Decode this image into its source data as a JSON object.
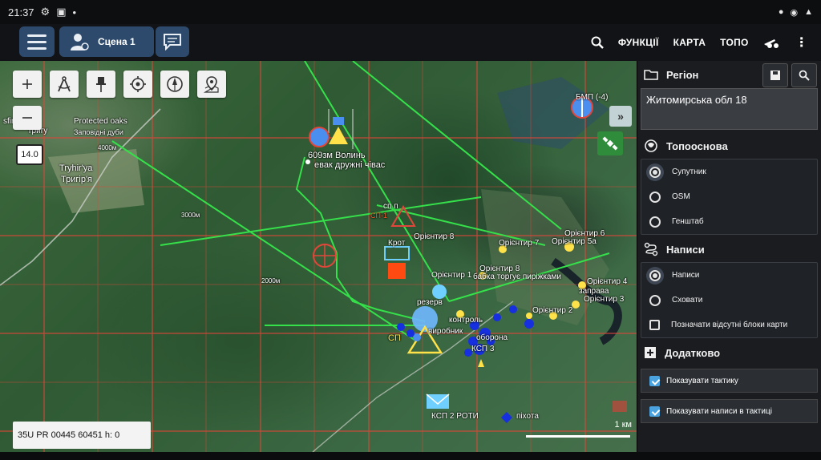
{
  "status": {
    "time": "21:37"
  },
  "header": {
    "scene_label": "Сцена 1",
    "nav": {
      "functions": "ФУНКЦІЇ",
      "map": "КАРТА",
      "topo": "ТОПО"
    }
  },
  "map": {
    "zoom": "14.0",
    "coords": "35U PR 00445 60451 h: 0",
    "scale": "1 км",
    "labels": {
      "protected_oaks": "Protected oaks",
      "zapovidni": "Заповідні дуби",
      "tryhiria_lat": "Tryhir'ya",
      "tryhiria_ua": "Тригір'я",
      "sfin": "sfin",
      "tygi": "Тригу",
      "bmp": "БМП (-4)",
      "volyn": "609зм Волинь",
      "evak": "евак дружні чівас",
      "sp_p": "сп п",
      "sp1": "СП-1",
      "krot": "Крот",
      "orient8a": "Орієнтир 8",
      "orient7": "Орієнтир 7",
      "orient6": "Орієнтир 6",
      "orient5a": "Орієнтир 5а",
      "orient8b": "Орієнтир 8",
      "babka": "бабка торгує пиріжками",
      "orient1": "Орієнтир 1",
      "orient4": "Орієнтир 4",
      "orient3": "Орієнтир 3",
      "orient2": "Орієнтир 2",
      "zapravka": "заправа",
      "rezerv": "резерв",
      "kontrol": "контроль",
      "vyrobnyk": "виробник",
      "oborona": "оборона",
      "ksp3": "КСП 3",
      "sp": "СП",
      "ksp2": "КСП 2 РОТИ",
      "pihota": "піхота",
      "dist1": "4000м",
      "dist2": "3000м",
      "dist3": "2000м"
    }
  },
  "panel": {
    "region": {
      "title": "Регіон",
      "value": "Житомирська обл 18"
    },
    "topo": {
      "title": "Топооснова",
      "options": [
        {
          "label": "Супутник",
          "selected": true
        },
        {
          "label": "OSM",
          "selected": false
        },
        {
          "label": "Генштаб",
          "selected": false
        }
      ]
    },
    "labels": {
      "title": "Написи",
      "options": [
        {
          "label": "Написи",
          "selected": true
        },
        {
          "label": "Сховати",
          "selected": false
        }
      ],
      "missing_blocks": "Позначати відсутні блоки карти"
    },
    "extra": {
      "title": "Додатково",
      "items": [
        {
          "label": "Показувати тактику",
          "checked": true
        },
        {
          "label": "Показувати написи в тактиці",
          "checked": true
        }
      ]
    }
  },
  "colors": {
    "accent": "#2d4a6c",
    "grid": "#e2463a",
    "route": "#35e04a",
    "panel": "#1a1c20"
  }
}
